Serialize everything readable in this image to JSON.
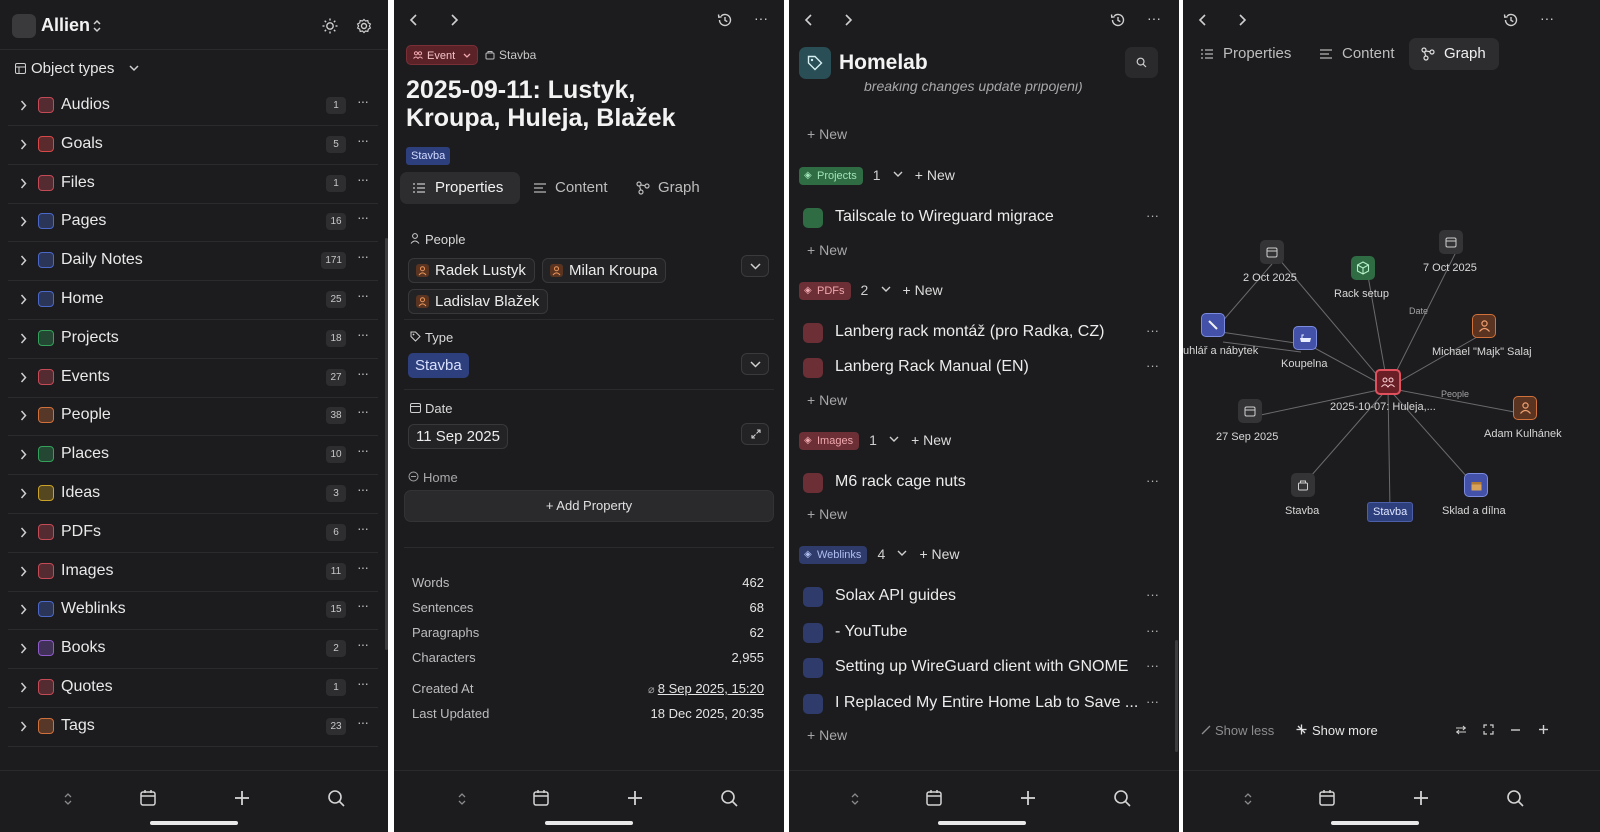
{
  "panel1": {
    "workspace": "Allien",
    "section_title": "Object types",
    "types": [
      {
        "label": "Audios",
        "count": "1",
        "color": "#c44a56",
        "icon": "audio-icon"
      },
      {
        "label": "Goals",
        "count": "5",
        "color": "#d84848",
        "icon": "target-icon"
      },
      {
        "label": "Files",
        "count": "1",
        "color": "#c44a56",
        "icon": "file-icon"
      },
      {
        "label": "Pages",
        "count": "16",
        "color": "#4b68c9",
        "icon": "page-icon"
      },
      {
        "label": "Daily Notes",
        "count": "171",
        "color": "#4b68c9",
        "icon": "calendar-icon"
      },
      {
        "label": "Home",
        "count": "25",
        "color": "#4b68c9",
        "icon": "house-icon"
      },
      {
        "label": "Projects",
        "count": "18",
        "color": "#34a05a",
        "icon": "cube-icon"
      },
      {
        "label": "Events",
        "count": "27",
        "color": "#c44a56",
        "icon": "people-icon"
      },
      {
        "label": "People",
        "count": "38",
        "color": "#d0703a",
        "icon": "person-icon"
      },
      {
        "label": "Places",
        "count": "10",
        "color": "#34a05a",
        "icon": "pin-icon"
      },
      {
        "label": "Ideas",
        "count": "3",
        "color": "#c9a227",
        "icon": "bulb-icon"
      },
      {
        "label": "PDFs",
        "count": "6",
        "color": "#c44a56",
        "icon": "pdf-icon"
      },
      {
        "label": "Images",
        "count": "11",
        "color": "#c44a56",
        "icon": "image-icon"
      },
      {
        "label": "Weblinks",
        "count": "15",
        "color": "#4b68c9",
        "icon": "globe-icon"
      },
      {
        "label": "Books",
        "count": "2",
        "color": "#8e5bc9",
        "icon": "book-icon"
      },
      {
        "label": "Quotes",
        "count": "1",
        "color": "#c44a56",
        "icon": "quote-icon"
      },
      {
        "label": "Tags",
        "count": "23",
        "color": "#d0703a",
        "icon": "tag-icon"
      }
    ]
  },
  "panel2": {
    "type_badge": "Event",
    "breadcrumb_set": "Stavba",
    "title_line1": "2025-09-11: Lustyk,",
    "title_line2": "Kroupa, Huleja, Blažek",
    "tag": "Stavba",
    "tabs": [
      "Properties",
      "Content",
      "Graph"
    ],
    "people_label": "People",
    "people": [
      "Radek Lustyk",
      "Milan Kroupa",
      "Ladislav Blažek"
    ],
    "type_label": "Type",
    "type_value": "Stavba",
    "date_label": "Date",
    "date_value": "11 Sep 2025",
    "home_label": "Home",
    "add_property": "+ Add Property",
    "stats": [
      {
        "label": "Words",
        "value": "462"
      },
      {
        "label": "Sentences",
        "value": "68"
      },
      {
        "label": "Paragraphs",
        "value": "62"
      },
      {
        "label": "Characters",
        "value": "2,955"
      }
    ],
    "created_label": "Created At",
    "created_value": "8 Sep 2025, 15:20",
    "updated_label": "Last Updated",
    "updated_value": "18 Dec 2025, 20:35"
  },
  "panel3": {
    "title": "Homelab",
    "cut_text": "breaking changes update pripojeni)",
    "new_label": "New",
    "sections": [
      {
        "tag": "Projects",
        "count": "1",
        "color": "#2f6b43",
        "text_color": "#9fe3b6",
        "items": [
          "Tailscale to Wireguard migrace"
        ],
        "item_color": "#2f6b43"
      },
      {
        "tag": "PDFs",
        "count": "2",
        "color": "#6b2f35",
        "text_color": "#f0a7ae",
        "items": [
          "Lanberg rack montáž (pro Radka, CZ)",
          "Lanberg Rack Manual (EN)"
        ],
        "item_color": "#6b2f35"
      },
      {
        "tag": "Images",
        "count": "1",
        "color": "#6b2f35",
        "text_color": "#f0a7ae",
        "items": [
          "M6 rack cage nuts"
        ],
        "item_color": "#6b2f35"
      },
      {
        "tag": "Weblinks",
        "count": "4",
        "color": "#2f3b6b",
        "text_color": "#aebdf0",
        "items": [
          "Solax API guides",
          "- YouTube",
          "Setting up WireGuard client with GNOME",
          "I Replaced My Entire Home Lab to Save ..."
        ],
        "item_color": "#2f3b6b"
      }
    ]
  },
  "panel4": {
    "tabs": [
      "Properties",
      "Content",
      "Graph"
    ],
    "nodes": {
      "oct2": "2 Oct 2025",
      "rack": "Rack setup",
      "oct7": "7 Oct 2025",
      "nabytek": "uhlář a nábytek",
      "koupelna": "Koupelna",
      "majk": "Michael \"Majk\" Salaj",
      "center": "2025-10-07: Huleja,...",
      "sep27": "27 Sep 2025",
      "adam": "Adam Kulhánek",
      "stavba1": "Stavba",
      "stavba2": "Stavba",
      "sklad": "Sklad a dílna"
    },
    "edge_date": "Date",
    "edge_people": "People",
    "show_less": "Show less",
    "show_more": "Show more"
  }
}
